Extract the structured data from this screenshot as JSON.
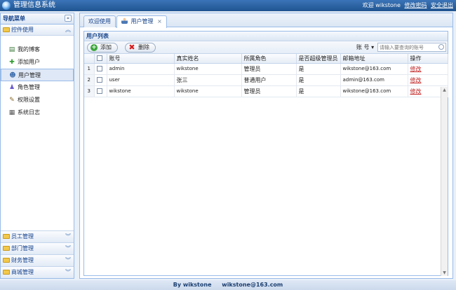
{
  "header": {
    "app_title": "管理信息系统",
    "welcome": "欢迎 wikstone",
    "change_password": "修改密码",
    "logout": "安全退出"
  },
  "sidebar": {
    "title": "导航菜单",
    "collapse_glyph": "«",
    "group": "控件使用",
    "items": [
      {
        "label": "我的博客",
        "icon": "blog-icon"
      },
      {
        "label": "添加用户",
        "icon": "add-user-icon"
      },
      {
        "label": "用户管理",
        "icon": "user-icon"
      },
      {
        "label": "角色管理",
        "icon": "role-icon"
      },
      {
        "label": "权限设置",
        "icon": "wrench-icon"
      },
      {
        "label": "系统日志",
        "icon": "log-icon"
      }
    ],
    "bottom_groups": [
      "员工管理",
      "部门管理",
      "财务管理",
      "商城管理"
    ]
  },
  "tabs": [
    {
      "label": "欢迎使用"
    },
    {
      "label": "用户管理",
      "close": "×"
    }
  ],
  "grid": {
    "title": "用户列表",
    "add_label": "添加",
    "delete_label": "删除",
    "search_field": "账 号",
    "search_placeholder": "请输入要查询的账号",
    "columns": [
      "账号",
      "真实姓名",
      "所属角色",
      "是否超级管理员",
      "邮箱地址",
      "操作"
    ],
    "rows": [
      {
        "num": "1",
        "account": "admin",
        "name": "wikstone",
        "role": "管理员",
        "super": "是",
        "email": "wikstone@163.com",
        "action": "修改"
      },
      {
        "num": "2",
        "account": "user",
        "name": "张三",
        "role": "普通用户",
        "super": "是",
        "email": "admin@163.com",
        "action": "修改"
      },
      {
        "num": "3",
        "account": "wikstone",
        "name": "wikstone",
        "role": "管理员",
        "super": "是",
        "email": "wikstone@163.com",
        "action": "修改"
      }
    ]
  },
  "footer": {
    "by": "By wikstone",
    "email": "wikstone@163.com"
  }
}
